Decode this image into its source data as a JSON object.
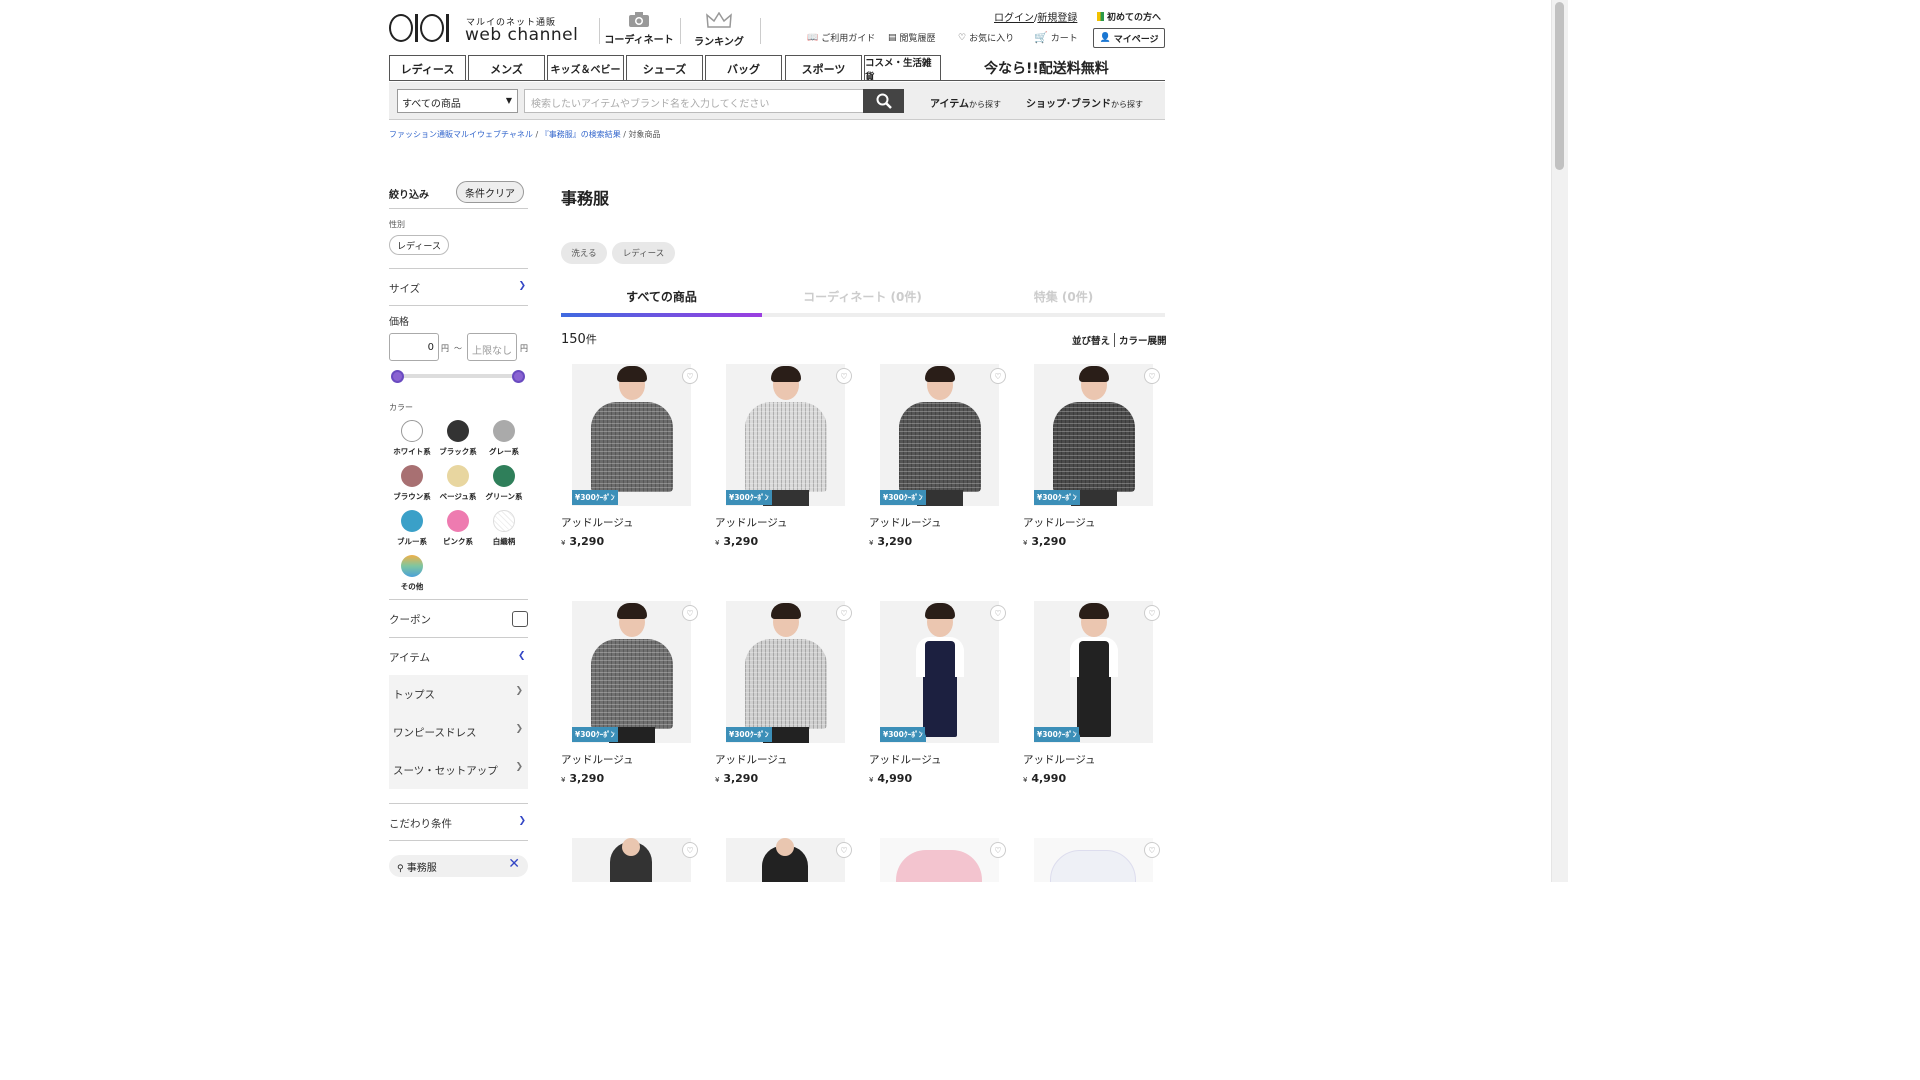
{
  "header": {
    "logo_sub": "マルイのネット通販",
    "logo_text": "web channel",
    "nav": [
      {
        "label": "コーディネート",
        "icon": "camera-icon"
      },
      {
        "label": "ランキング",
        "icon": "crown-icon"
      }
    ],
    "login": "ログイン",
    "register": "新規登録",
    "first_time": "初めての方へ",
    "util": [
      {
        "label": "ご利用ガイド",
        "icon": "book-icon"
      },
      {
        "label": "閲覧履歴",
        "icon": "history-icon"
      },
      {
        "label": "お気に入り",
        "icon": "heart-icon"
      },
      {
        "label": "カート",
        "icon": "cart-icon"
      }
    ],
    "mypage": "マイページ"
  },
  "categories": [
    "レディース",
    "メンズ",
    "キッズ＆ベビー",
    "シューズ",
    "バッグ",
    "スポーツ",
    "コスメ・生活雑貨"
  ],
  "promo": "今なら!!配送料無料",
  "search": {
    "select_value": "すべての商品",
    "placeholder": "検索したいアイテムやブランド名を入力してください",
    "item_link": "アイテム",
    "shop_link": "ショップ･ブランド",
    "link_suffix": "から探す"
  },
  "breadcrumb": {
    "home": "ファッション通販マルイウェブチャネル",
    "search": "『事務服』の検索結果",
    "current": "対象商品"
  },
  "filters": {
    "title": "絞り込み",
    "clear": "条件クリア",
    "gender_label": "性別",
    "gender_value": "レディース",
    "size": "サイズ",
    "price": "価格",
    "price_min": "0",
    "price_max_placeholder": "上限なし",
    "yen": "円",
    "tilde": "～",
    "color_label": "カラー",
    "colors": [
      {
        "label": "ホワイト系",
        "hex": "#ffffff"
      },
      {
        "label": "ブラック系",
        "hex": "#333333"
      },
      {
        "label": "グレー系",
        "hex": "#aaaaaa"
      },
      {
        "label": "ブラウン系",
        "hex": "#a87072"
      },
      {
        "label": "ベージュ系",
        "hex": "#e8d6a0"
      },
      {
        "label": "グリーン系",
        "hex": "#2f7f5a"
      },
      {
        "label": "ブルー系",
        "hex": "#3aa0c8"
      },
      {
        "label": "ピンク系",
        "hex": "#ee7bb0"
      },
      {
        "label": "白織柄",
        "hex": "#ffffff"
      },
      {
        "label": "その他",
        "hex": "#f0b048"
      }
    ],
    "coupon": "クーポン",
    "item": "アイテム",
    "item_children": [
      "トップス",
      "ワンピースドレス",
      "スーツ・セットアップ"
    ],
    "kodawari": "こだわり条件",
    "keyword": "事務服"
  },
  "main": {
    "title": "事務服",
    "tags": [
      "洗える",
      "レディース"
    ],
    "tabs": [
      "すべての商品",
      "コーディネート (0件)",
      "特集 (0件)"
    ],
    "count": "150",
    "count_unit": "件",
    "sort": "並び替え",
    "color_expand": "カラー展開",
    "coupon_label": "¥300ｸｰﾎﾟﾝ",
    "currency": "¥",
    "products": [
      {
        "brand": "アッドルージュ",
        "price": "3,290"
      },
      {
        "brand": "アッドルージュ",
        "price": "3,290"
      },
      {
        "brand": "アッドルージュ",
        "price": "3,290"
      },
      {
        "brand": "アッドルージュ",
        "price": "3,290"
      },
      {
        "brand": "アッドルージュ",
        "price": "3,290"
      },
      {
        "brand": "アッドルージュ",
        "price": "3,290"
      },
      {
        "brand": "アッドルージュ",
        "price": "4,990"
      },
      {
        "brand": "アッドルージュ",
        "price": "4,990"
      }
    ]
  }
}
